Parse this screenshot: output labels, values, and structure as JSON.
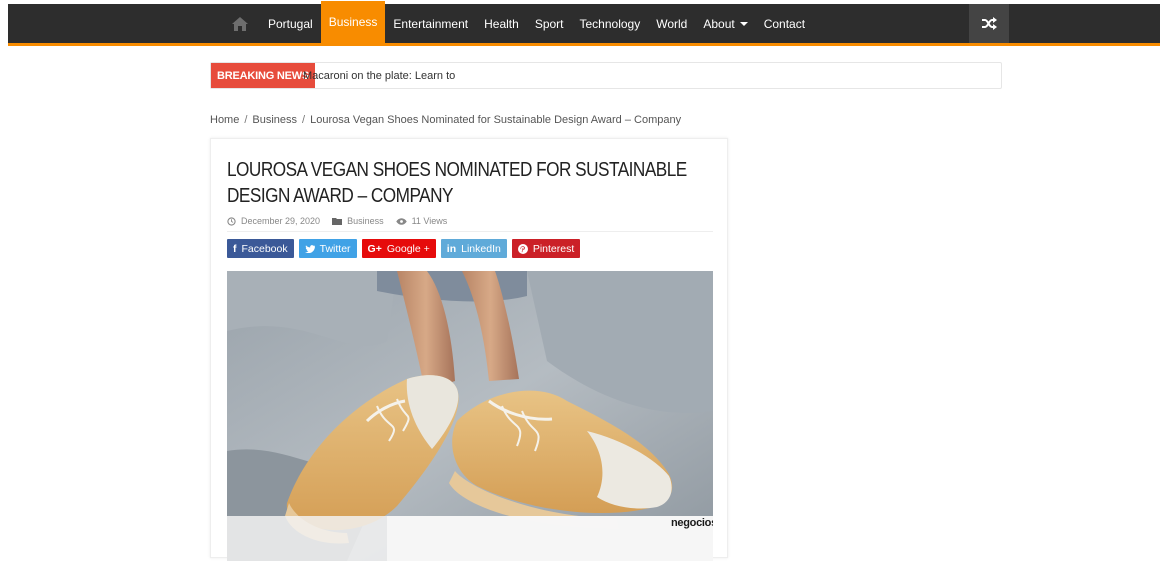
{
  "nav": {
    "items": [
      {
        "label": "Portugal"
      },
      {
        "label": "Business",
        "active": true
      },
      {
        "label": "Entertainment"
      },
      {
        "label": "Health"
      },
      {
        "label": "Sport"
      },
      {
        "label": "Technology"
      },
      {
        "label": "World"
      },
      {
        "label": "About",
        "dropdown": true
      },
      {
        "label": "Contact"
      }
    ],
    "home_icon": "home-icon",
    "random_icon": "shuffle-icon",
    "accent_color": "#f88c00",
    "bar_color": "#2d2d2d"
  },
  "breaking": {
    "tag": "Breaking News",
    "tag_color": "#e74c3c",
    "headline": "Macaroni on the plate: Learn to"
  },
  "breadcrumb": {
    "home": "Home",
    "category": "Business",
    "current": "Lourosa Vegan Shoes Nominated for Sustainable Design Award – Company"
  },
  "article": {
    "title": "Lourosa Vegan Shoes Nominated for Sustainable Design Award – Company",
    "date": "December 29, 2020",
    "category": "Business",
    "views": "11 Views",
    "image_watermark": "negocios"
  },
  "share": {
    "facebook": {
      "icon": "f",
      "label": "Facebook",
      "color": "#3b5998"
    },
    "twitter": {
      "icon": "🐦",
      "label": "Twitter",
      "color": "#40a2e6"
    },
    "google": {
      "icon": "G+",
      "label": "Google +",
      "color": "#e60b0b"
    },
    "linkedin": {
      "icon": "in",
      "label": "LinkedIn",
      "color": "#5faad9"
    },
    "pinterest": {
      "icon": "P",
      "label": "Pinterest",
      "color": "#cb2027"
    }
  }
}
